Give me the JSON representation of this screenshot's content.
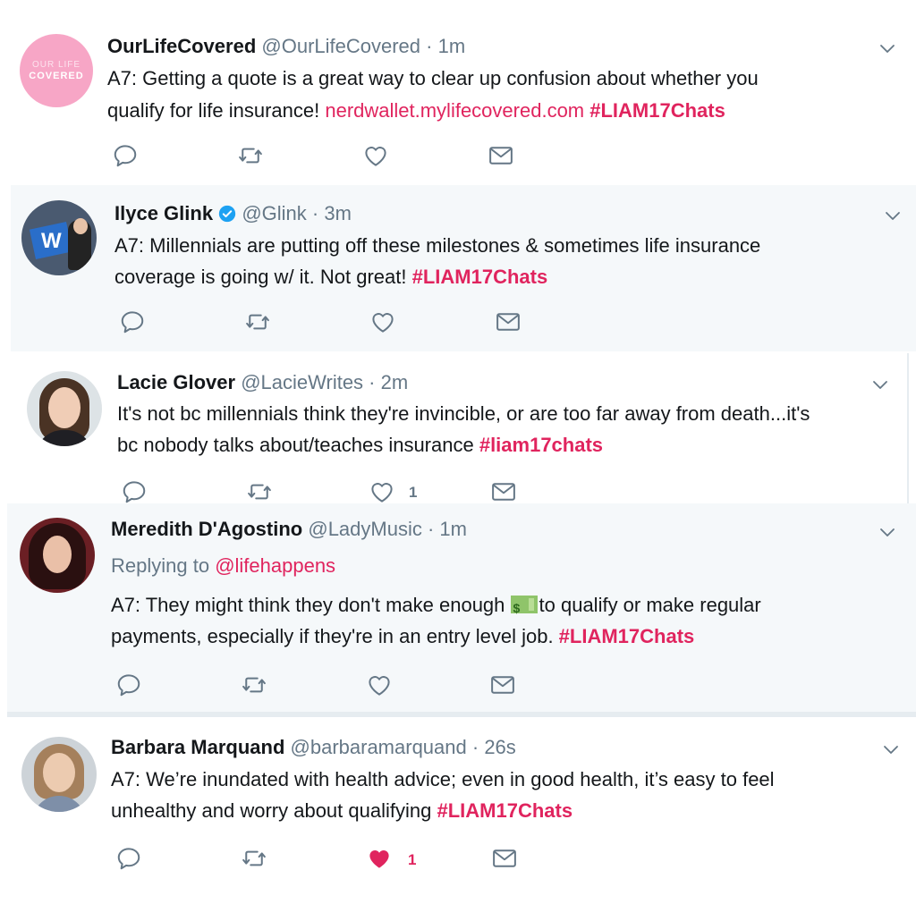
{
  "colors": {
    "accent": "#e0245e",
    "meta": "#657786",
    "highlight_bg": "#f5f8fa",
    "verified": "#1da1f2"
  },
  "tweets": [
    {
      "display_name": "OurLifeCovered",
      "handle": "@OurLifeCovered",
      "time": "1m",
      "avatar_logo": [
        "OUR LIFE",
        "COVERED"
      ],
      "line1": "A7: Getting a quote is a great way to clear up confusion about whether you",
      "line2_text": "qualify for life insurance! ",
      "link": "nerdwallet.mylifecovered.com",
      "hashtag": "#LIAM17Chats"
    },
    {
      "display_name": "Ilyce Glink",
      "handle": "@Glink",
      "time": "3m",
      "verified": true,
      "line1": "A7: Millennials are putting off these milestones & sometimes life insurance",
      "line2_text": "coverage is going w/ it. Not great! ",
      "hashtag": "#LIAM17Chats"
    },
    {
      "display_name": "Lacie Glover",
      "handle": "@LacieWrites",
      "time": "2m",
      "line1": "It's not bc millennials think they're invincible, or are too far away from death...it's",
      "line2_text": "bc nobody talks about/teaches insurance ",
      "hashtag": "#liam17chats",
      "like_count": "1"
    },
    {
      "display_name": "Meredith D'Agostino",
      "handle": "@LadyMusic",
      "time": "1m",
      "replying_label": "Replying to ",
      "replying_to": "@lifehappens",
      "line1_a": "A7: They might think they don't make enough ",
      "line1_b": "to qualify or make regular",
      "line2_text": "payments, especially if they're in an entry level job. ",
      "hashtag": "#LIAM17Chats"
    },
    {
      "display_name": "Barbara Marquand",
      "handle": "@barbaramarquand",
      "time": "26s",
      "line1": "A7: We’re inundated with health advice; even in good health, it’s easy to feel",
      "line2_text": "unhealthy and worry about qualifying  ",
      "hashtag": "#LIAM17Chats",
      "like_count": "1",
      "liked": true
    }
  ]
}
